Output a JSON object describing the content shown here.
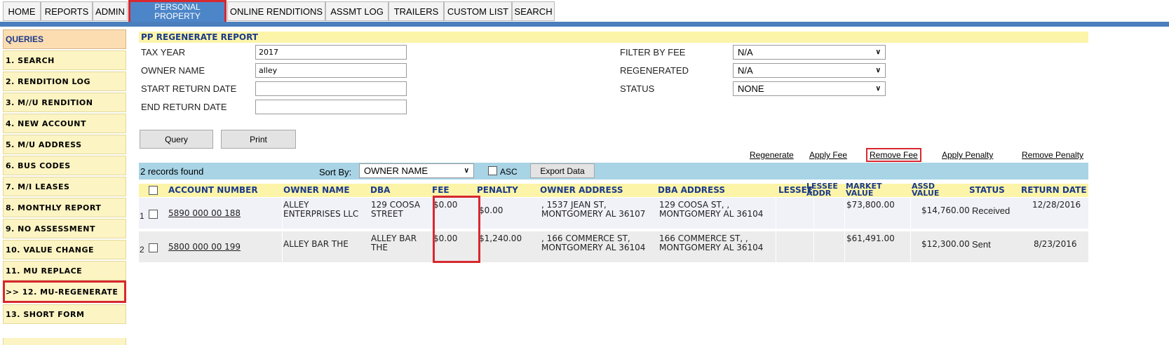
{
  "topnav": {
    "tabs": [
      {
        "label": "HOME"
      },
      {
        "label": "REPORTS"
      },
      {
        "label": "ADMIN"
      },
      {
        "label_line1": "PERSONAL",
        "label_line2": "PROPERTY"
      },
      {
        "label": "ONLINE RENDITIONS"
      },
      {
        "label": "ASSMT LOG"
      },
      {
        "label": "TRAILERS"
      },
      {
        "label": "CUSTOM LIST"
      },
      {
        "label": "SEARCH"
      }
    ]
  },
  "sidebar": {
    "heading": "QUERIES",
    "items": [
      {
        "label": "1. SEARCH"
      },
      {
        "label": "2. RENDITION LOG"
      },
      {
        "label": "3. M//U RENDITION"
      },
      {
        "label": "4. NEW ACCOUNT"
      },
      {
        "label": "5. M/U ADDRESS"
      },
      {
        "label": "6. BUS CODES"
      },
      {
        "label": "7. M/I LEASES"
      },
      {
        "label": "8. MONTHLY REPORT"
      },
      {
        "label": "9. NO ASSESSMENT"
      },
      {
        "label": "10. VALUE CHANGE"
      },
      {
        "label": "11. MU REPLACE"
      },
      {
        "label": ">> 12. MU-REGENERATE"
      },
      {
        "label": "13. SHORT FORM"
      }
    ]
  },
  "report": {
    "title": "PP REGENERATE REPORT",
    "fields": {
      "tax_year_label": "TAX YEAR",
      "tax_year_value": "2017",
      "owner_name_label": "OWNER NAME",
      "owner_name_value": "alley",
      "start_return_label": "START RETURN DATE",
      "start_return_value": "",
      "end_return_label": "END RETURN DATE",
      "end_return_value": "",
      "filter_fee_label": "FILTER BY FEE",
      "filter_fee_value": "N/A",
      "regenerated_label": "REGENERATED",
      "regenerated_value": "N/A",
      "status_label": "STATUS",
      "status_value": "NONE"
    },
    "buttons": {
      "query": "Query",
      "print": "Print",
      "export": "Export Data"
    },
    "actions": {
      "regenerate": "Regenerate",
      "apply_fee": "Apply Fee",
      "remove_fee": "Remove Fee",
      "apply_penalty": "Apply Penalty",
      "remove_penalty": "Remove Penalty"
    },
    "records": {
      "count_text": "2 records found",
      "sort_by_label": "Sort By:",
      "sort_by_value": "OWNER NAME",
      "asc_label": "ASC"
    }
  },
  "table": {
    "headers": {
      "account": "ACCOUNT NUMBER",
      "owner": "OWNER NAME",
      "dba": "DBA",
      "fee": "FEE",
      "penalty": "PENALTY",
      "owner_address": "OWNER ADDRESS",
      "dba_address": "DBA ADDRESS",
      "lessee": "LESSEE",
      "lessee_addr": "LESSEE ADDR",
      "market_value": "MARKET VALUE",
      "assd_value": "ASSD VALUE",
      "status": "STATUS",
      "return_date": "RETURN DATE"
    },
    "rows": [
      {
        "num": "1",
        "account": "5890 000 00 188",
        "owner_l1": "ALLEY",
        "owner_l2": "ENTERPRISES LLC",
        "dba_l1": "129 COOSA",
        "dba_l2": "STREET",
        "fee": "$0.00",
        "penalty": "$0.00",
        "owner_addr_l1": ", 1537 JEAN ST,",
        "owner_addr_l2": "MONTGOMERY AL 36107",
        "dba_addr_l1": "129 COOSA ST, ,",
        "dba_addr_l2": "MONTGOMERY AL 36104",
        "market_value": "$73,800.00",
        "assd_value": "$14,760.00",
        "status": "Received",
        "return_date": "12/28/2016"
      },
      {
        "num": "2",
        "account": "5800 000 00 199",
        "owner_l1": "ALLEY BAR THE",
        "owner_l2": "",
        "dba_l1": "ALLEY BAR",
        "dba_l2": "THE",
        "fee": "$0.00",
        "penalty": "$1,240.00",
        "owner_addr_l1": ", 166 COMMERCE ST,",
        "owner_addr_l2": "MONTGOMERY AL 36104",
        "dba_addr_l1": "166 COMMERCE ST, ,",
        "dba_addr_l2": "MONTGOMERY AL 36104",
        "market_value": "$61,491.00",
        "assd_value": "$12,300.00",
        "status": "Sent",
        "return_date": "8/23/2016"
      }
    ]
  },
  "colors": {
    "accent_blue": "#4a7ebd",
    "highlight_red": "#d7282f",
    "header_yellow": "#fcf4a8",
    "records_bar": "#a8d4e6"
  }
}
